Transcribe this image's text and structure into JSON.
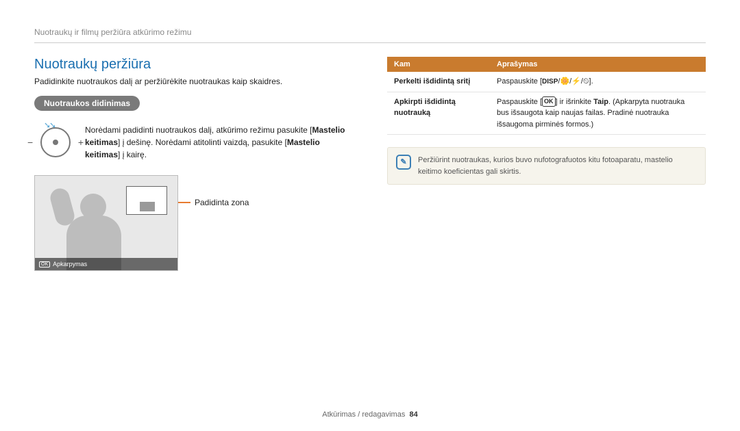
{
  "breadcrumb": "Nuotraukų ir filmų peržiūra atkūrimo režimu",
  "title": "Nuotraukų peržiūra",
  "intro": "Padidinkite nuotraukos dalį ar peržiūrėkite nuotraukas kaip skaidres.",
  "pill": "Nuotraukos didinimas",
  "zoom_pre": "Norėdami padidinti nuotraukos dalį, atkūrimo režimu pasukite [",
  "zoom_bold1": "Mastelio keitimas",
  "zoom_mid": "] į dešinę. Norėdami atitolinti vaizdą, pasukite [",
  "zoom_bold2": "Mastelio keitimas",
  "zoom_post": "] į kairę.",
  "strip_ok": "OK",
  "strip_label": "Apkarpymas",
  "callout": "Padidinta zona",
  "table": {
    "head1": "Kam",
    "head2": "Aprašymas",
    "r1k": "Perkelti išdidintą sritį",
    "r1v_pre": "Paspauskite [",
    "r1v_disp": "DISP",
    "r1v_icons": "/🌼/⚡/⏲",
    "r1v_post": "].",
    "r2k": "Apkirpti išdidintą nuotrauką",
    "r2v_pre": "Paspauskite [",
    "r2v_ok": "OK",
    "r2v_mid": "] ir išrinkite ",
    "r2v_bold": "Taip",
    "r2v_post": ". (Apkarpyta nuotrauka bus išsaugota kaip naujas failas. Pradinė nuotrauka išsaugoma pirminės formos.)"
  },
  "note_icon": "✎",
  "note_text": "Peržiūrint nuotraukas, kurios buvo nufotografuotos kitu fotoaparatu, mastelio keitimo koeficientas gali skirtis.",
  "footer_section": "Atkūrimas / redagavimas",
  "footer_page": "84"
}
